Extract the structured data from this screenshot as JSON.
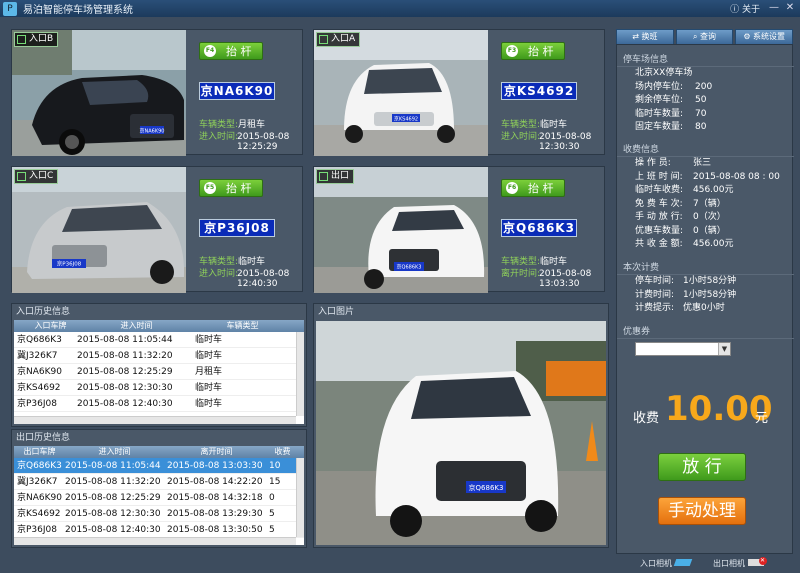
{
  "app": {
    "title": "易泊智能停车场管理系统",
    "about": "关于"
  },
  "window": {
    "minimize": "—",
    "close": "✕"
  },
  "cams": [
    {
      "tag": "入口B",
      "key": "F4",
      "lift": "抬 杆",
      "plate": "京NA6K90",
      "type_label": "车辆类型:",
      "type": "月租车",
      "time_label": "进入时间:",
      "date": "2015-08-08",
      "clock": "12:25:29",
      "photo_plate": "京NA6K90"
    },
    {
      "tag": "入口A",
      "key": "F3",
      "lift": "抬 杆",
      "plate": "京KS4692",
      "type_label": "车辆类型:",
      "type": "临时车",
      "time_label": "进入时间:",
      "date": "2015-08-08",
      "clock": "12:30:30",
      "photo_plate": "京KS4692"
    },
    {
      "tag": "入口C",
      "key": "F5",
      "lift": "抬 杆",
      "plate": "京P36J08",
      "type_label": "车辆类型:",
      "type": "临时车",
      "time_label": "进入时间:",
      "date": "2015-08-08",
      "clock": "12:40:30",
      "photo_plate": "京P36J08"
    },
    {
      "tag": "出口",
      "key": "F6",
      "lift": "抬 杆",
      "plate": "京Q686K3",
      "type_label": "车辆类型:",
      "type": "临时车",
      "time_label": "离开时间:",
      "date": "2015-08-08",
      "clock": "13:03:30",
      "photo_plate": "京Q686K3"
    }
  ],
  "entry_history": {
    "title": "入口历史信息",
    "columns": [
      "入口车牌",
      "进入时间",
      "车辆类型"
    ],
    "rows": [
      [
        "京Q686K3",
        "2015-08-08  11:05:44",
        "临时车"
      ],
      [
        "冀J326K7",
        "2015-08-08  11:32:20",
        "临时车"
      ],
      [
        "京NA6K90",
        "2015-08-08  12:25:29",
        "月租车"
      ],
      [
        "京KS4692",
        "2015-08-08  12:30:30",
        "临时车"
      ],
      [
        "京P36J08",
        "2015-08-08  12:40:30",
        "临时车"
      ]
    ]
  },
  "exit_history": {
    "title": "出口历史信息",
    "columns": [
      "出口车牌",
      "进入时间",
      "离开时间",
      "收费"
    ],
    "rows": [
      [
        "京Q686K3",
        "2015-08-08  11:05:44",
        "2015-08-08  13:03:30",
        "10"
      ],
      [
        "冀J326K7",
        "2015-08-08  11:32:20",
        "2015-08-08  14:22:20",
        "15"
      ],
      [
        "京NA6K90",
        "2015-08-08  12:25:29",
        "2015-08-08  14:32:18",
        "0"
      ],
      [
        "京KS4692",
        "2015-08-08  12:30:30",
        "2015-08-08  13:29:30",
        "5"
      ],
      [
        "京P36J08",
        "2015-08-08  12:40:30",
        "2015-08-08  13:30:50",
        "5"
      ]
    ]
  },
  "entry_image": {
    "title": "入口图片",
    "plate": "京Q686K3"
  },
  "side": {
    "buttons": [
      "换班",
      "查询",
      "系统设置"
    ],
    "parking": {
      "title": "停车场信息",
      "name": "北京XX停车场",
      "lines": [
        [
          "场内停车位:",
          "200"
        ],
        [
          "剩余停车位:",
          "50"
        ],
        [
          "临时车数量:",
          "70"
        ],
        [
          "固定车数量:",
          "80"
        ]
      ]
    },
    "charge": {
      "title": "收费信息",
      "lines": [
        [
          "操 作 员:",
          "张三"
        ],
        [
          "上 班 时 间:",
          "2015-08-08 08 : 00"
        ],
        [
          "临时车收费:",
          "456.00元"
        ],
        [
          "免 费 车 次:",
          "7（辆）"
        ],
        [
          "手 动 放 行:",
          "0（次）"
        ],
        [
          "优惠车数量:",
          "0（辆）"
        ],
        [
          "共 收 金 额:",
          "456.00元"
        ]
      ]
    },
    "current": {
      "title": "本次计费",
      "lines": [
        [
          "停车时间:",
          "1小时58分钟"
        ],
        [
          "计费时间:",
          "1小时58分钟"
        ],
        [
          "计费提示:",
          "优惠0小时"
        ]
      ]
    },
    "coupon": {
      "title": "优惠券",
      "value": ""
    },
    "fee": {
      "label": "收费",
      "amount": "10.00",
      "unit": "元"
    },
    "release": "放 行",
    "manual": "手动处理"
  },
  "status": {
    "entry_cam": "入口相机",
    "exit_cam": "出口相机"
  },
  "colors": {
    "accent": "#f7a81b",
    "green": "#5fb32a",
    "orange": "#f08a1a",
    "plate_blue": "#0a2bb8"
  }
}
